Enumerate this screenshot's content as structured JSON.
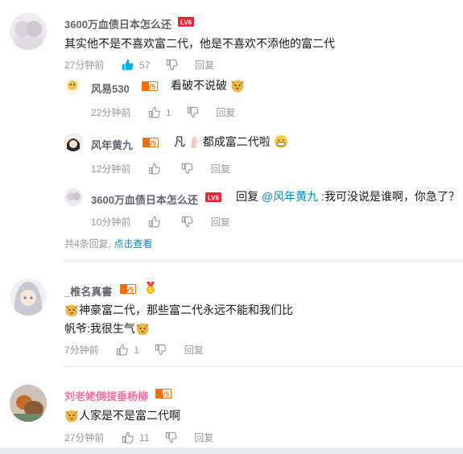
{
  "comments": [
    {
      "username": "3600万血债日本怎么还",
      "level": "LV6",
      "text": "其实他不是不喜欢富二代，他是不喜欢不添他的富二代",
      "time": "27分钟前",
      "likes": "57",
      "reply_label": "回复",
      "replies": [
        {
          "username": "风易530",
          "level": "LV5",
          "text": "看破不说破",
          "time": "22分钟前",
          "likes": "1",
          "reply_label": "回复"
        },
        {
          "username": "风年黄九",
          "level": "LV5",
          "text_prefix": "凡",
          "text_suffix": "都成富二代啦",
          "time": "12分钟前",
          "likes": "",
          "reply_label": "回复"
        },
        {
          "username": "3600万血债日本怎么还",
          "level": "LV6",
          "reply_word": "回复",
          "mention": "@风年黄九",
          "text": ":我可没说是谁啊，你急了？",
          "time": "10分钟前",
          "likes": "",
          "reply_label": "回复"
        }
      ],
      "more_prefix": "共4条回复,",
      "more_link": "点击查看"
    },
    {
      "username": "_椎名真書",
      "level": "LV5",
      "text_line1": "神豪富二代，那些富二代永远不能和我们比",
      "text_line2": "帆爷:我很生气",
      "time": "7分钟前",
      "likes": "1",
      "reply_label": "回复"
    },
    {
      "username": "刘老姥倒拔垂杨柳",
      "level": "LV5",
      "text": "人家是不是富二代啊",
      "time": "27分钟前",
      "likes": "11",
      "reply_label": "回复"
    }
  ],
  "colors": {
    "level6": "#ff6c00",
    "level5": "#ff6c00",
    "blue_like": "#00aeec",
    "link": "#008ac5",
    "pink_name": "#fb7299"
  }
}
